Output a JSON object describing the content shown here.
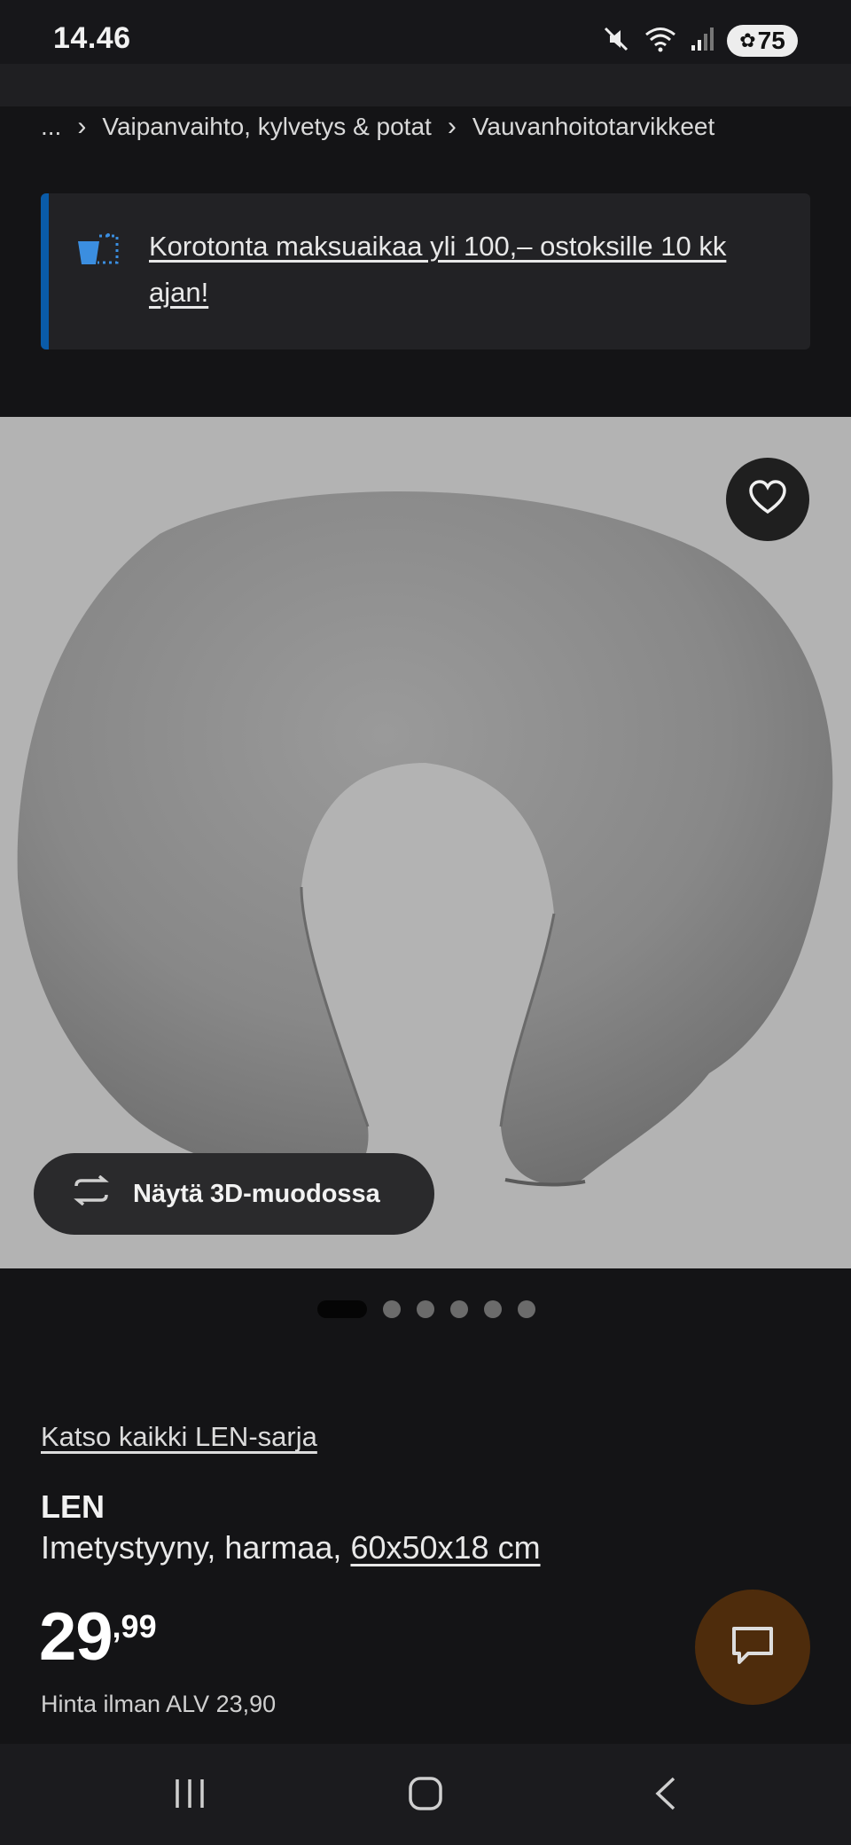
{
  "status_bar": {
    "time": "14.46",
    "battery": "75",
    "icons": [
      "mute-icon",
      "wifi-icon",
      "signal-icon",
      "battery-icon"
    ]
  },
  "breadcrumb": {
    "ellipsis": "...",
    "items": [
      "Vaipanvaihto, kylvetys & potat",
      "Vauvanhoitotarvikkeet"
    ]
  },
  "banner": {
    "text": "Korotonta maksuaikaa yli 100,– ostoksille 10 kk ajan!",
    "accent_color": "#0a5ba8",
    "icon": "basket-icon"
  },
  "gallery": {
    "view_3d_label": "Näytä 3D-muodossa",
    "image_count": 6,
    "active_index": 0
  },
  "product": {
    "series_link": "Katso kaikki LEN-sarja",
    "name": "LEN",
    "description": "Imetystyyny, harmaa,",
    "size": "60x50x18 cm",
    "price_int": "29",
    "price_dec": ",99",
    "price_vat": "Hinta ilman ALV 23,90"
  },
  "colors": {
    "background": "#141416",
    "chat_button": "#4e2c0c"
  }
}
